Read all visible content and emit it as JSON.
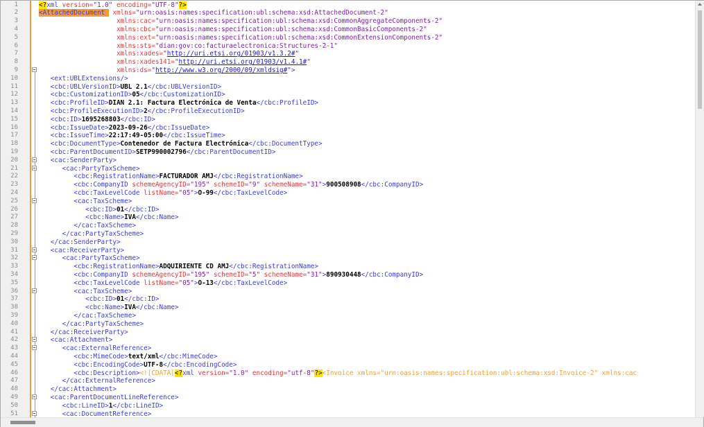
{
  "editor": {
    "lines": [
      {
        "n": "1",
        "segs": [
          [
            "pi",
            "<?"
          ],
          [
            "pitext",
            "xml "
          ],
          [
            "attr",
            "version="
          ],
          [
            "val",
            "\"1.0\""
          ],
          [
            "attr",
            " encoding="
          ],
          [
            "val",
            "\"UTF-8\""
          ],
          [
            "pi",
            "?>"
          ]
        ]
      },
      {
        "n": "2",
        "segs": [
          [
            "hl",
            "<AttachedDocument "
          ],
          [
            "attr",
            " xmlns="
          ],
          [
            "val",
            "\"urn:oasis:names:specification:ubl:schema:xsd:AttachedDocument-2\""
          ]
        ]
      },
      {
        "n": "3",
        "segs": [
          [
            "plain",
            "                    "
          ],
          [
            "attr",
            "xmlns:cac="
          ],
          [
            "val",
            "\"urn:oasis:names:specification:ubl:schema:xsd:CommonAggregateComponents-2\""
          ]
        ]
      },
      {
        "n": "4",
        "segs": [
          [
            "plain",
            "                    "
          ],
          [
            "attr",
            "xmlns:cbc="
          ],
          [
            "val",
            "\"urn:oasis:names:specification:ubl:schema:xsd:CommonBasicComponents-2\""
          ]
        ]
      },
      {
        "n": "5",
        "segs": [
          [
            "plain",
            "                    "
          ],
          [
            "attr",
            "xmlns:ext="
          ],
          [
            "val",
            "\"urn:oasis:names:specification:ubl:schema:xsd:CommonExtensionComponents-2\""
          ]
        ]
      },
      {
        "n": "6",
        "segs": [
          [
            "plain",
            "                    "
          ],
          [
            "attr",
            "xmlns:sts="
          ],
          [
            "val",
            "\"dian:gov:co:facturaelectronica:Structures-2-1\""
          ]
        ]
      },
      {
        "n": "7",
        "segs": [
          [
            "plain",
            "                    "
          ],
          [
            "attr",
            "xmlns:xades="
          ],
          [
            "val",
            "\""
          ],
          [
            "link",
            "http://uri.etsi.org/01903/v1.3.2#"
          ],
          [
            "val",
            "\""
          ]
        ]
      },
      {
        "n": "8",
        "segs": [
          [
            "plain",
            "                    "
          ],
          [
            "attr",
            "xmlns:xades141="
          ],
          [
            "val",
            "\""
          ],
          [
            "link",
            "http://uri.etsi.org/01903/v1.4.1#"
          ],
          [
            "val",
            "\""
          ]
        ]
      },
      {
        "n": "9",
        "fold": true,
        "segs": [
          [
            "plain",
            "                    "
          ],
          [
            "attr",
            "xmlns:ds="
          ],
          [
            "val",
            "\""
          ],
          [
            "link",
            "http://www.w3.org/2000/09/xmldsig#"
          ],
          [
            "val",
            "\""
          ],
          [
            "tag",
            ">"
          ]
        ]
      },
      {
        "n": "10",
        "segs": [
          [
            "plain",
            "   "
          ],
          [
            "tag",
            "<ext:UBLExtensions/>"
          ]
        ]
      },
      {
        "n": "11",
        "segs": [
          [
            "plain",
            "   "
          ],
          [
            "tag",
            "<cbc:UBLVersionID>"
          ],
          [
            "bold",
            "UBL 2.1"
          ],
          [
            "tag",
            "</cbc:UBLVersionID>"
          ]
        ]
      },
      {
        "n": "12",
        "segs": [
          [
            "plain",
            "   "
          ],
          [
            "tag",
            "<cbc:CustomizationID>"
          ],
          [
            "bold",
            "05"
          ],
          [
            "tag",
            "</cbc:CustomizationID>"
          ]
        ]
      },
      {
        "n": "13",
        "segs": [
          [
            "plain",
            "   "
          ],
          [
            "tag",
            "<cbc:ProfileID>"
          ],
          [
            "bold",
            "DIAN 2.1: Factura Electrónica de Venta"
          ],
          [
            "tag",
            "</cbc:ProfileID>"
          ]
        ]
      },
      {
        "n": "14",
        "segs": [
          [
            "plain",
            "   "
          ],
          [
            "tag",
            "<cbc:ProfileExecutionID>"
          ],
          [
            "bold",
            "2"
          ],
          [
            "tag",
            "</cbc:ProfileExecutionID>"
          ]
        ]
      },
      {
        "n": "15",
        "segs": [
          [
            "plain",
            "   "
          ],
          [
            "tag",
            "<cbc:ID>"
          ],
          [
            "bold",
            "1695268803"
          ],
          [
            "tag",
            "</cbc:ID>"
          ]
        ]
      },
      {
        "n": "16",
        "segs": [
          [
            "plain",
            "   "
          ],
          [
            "tag",
            "<cbc:IssueDate>"
          ],
          [
            "bold",
            "2023-09-26"
          ],
          [
            "tag",
            "</cbc:IssueDate>"
          ]
        ]
      },
      {
        "n": "17",
        "segs": [
          [
            "plain",
            "   "
          ],
          [
            "tag",
            "<cbc:IssueTime>"
          ],
          [
            "bold",
            "22:17:49-05:00"
          ],
          [
            "tag",
            "</cbc:IssueTime>"
          ]
        ]
      },
      {
        "n": "18",
        "segs": [
          [
            "plain",
            "   "
          ],
          [
            "tag",
            "<cbc:DocumentType>"
          ],
          [
            "bold",
            "Contenedor de Factura Electrónica"
          ],
          [
            "tag",
            "</cbc:DocumentType>"
          ]
        ]
      },
      {
        "n": "19",
        "segs": [
          [
            "plain",
            "   "
          ],
          [
            "tag",
            "<cbc:ParentDocumentID>"
          ],
          [
            "bold",
            "SETP990002796"
          ],
          [
            "tag",
            "</cbc:ParentDocumentID>"
          ]
        ]
      },
      {
        "n": "20",
        "fold": true,
        "segs": [
          [
            "plain",
            "   "
          ],
          [
            "tag",
            "<cac:SenderParty>"
          ]
        ]
      },
      {
        "n": "21",
        "fold": true,
        "segs": [
          [
            "plain",
            "      "
          ],
          [
            "tag",
            "<cac:PartyTaxScheme>"
          ]
        ]
      },
      {
        "n": "22",
        "segs": [
          [
            "plain",
            "         "
          ],
          [
            "tag",
            "<cbc:RegistrationName>"
          ],
          [
            "bold",
            "FACTURADOR AMJ"
          ],
          [
            "tag",
            "</cbc:RegistrationName>"
          ]
        ]
      },
      {
        "n": "23",
        "segs": [
          [
            "plain",
            "         "
          ],
          [
            "tag",
            "<cbc:CompanyID "
          ],
          [
            "attr",
            "schemeAgencyID="
          ],
          [
            "val",
            "\"195\""
          ],
          [
            "attr",
            " schemeID="
          ],
          [
            "val",
            "\"9\""
          ],
          [
            "attr",
            " schemeName="
          ],
          [
            "val",
            "\"31\""
          ],
          [
            "tag",
            ">"
          ],
          [
            "bold",
            "900508908"
          ],
          [
            "tag",
            "</cbc:CompanyID>"
          ]
        ]
      },
      {
        "n": "24",
        "segs": [
          [
            "plain",
            "         "
          ],
          [
            "tag",
            "<cbc:TaxLevelCode "
          ],
          [
            "attr",
            "listName="
          ],
          [
            "val",
            "\"05\""
          ],
          [
            "tag",
            ">"
          ],
          [
            "bold",
            "O-99"
          ],
          [
            "tag",
            "</cbc:TaxLevelCode>"
          ]
        ]
      },
      {
        "n": "25",
        "fold": true,
        "segs": [
          [
            "plain",
            "         "
          ],
          [
            "tag",
            "<cac:TaxScheme>"
          ]
        ]
      },
      {
        "n": "26",
        "segs": [
          [
            "plain",
            "            "
          ],
          [
            "tag",
            "<cbc:ID>"
          ],
          [
            "bold",
            "01"
          ],
          [
            "tag",
            "</cbc:ID>"
          ]
        ]
      },
      {
        "n": "27",
        "segs": [
          [
            "plain",
            "            "
          ],
          [
            "tag",
            "<cbc:Name>"
          ],
          [
            "bold",
            "IVA"
          ],
          [
            "tag",
            "</cbc:Name>"
          ]
        ]
      },
      {
        "n": "28",
        "segs": [
          [
            "plain",
            "         "
          ],
          [
            "tag",
            "</cac:TaxScheme>"
          ]
        ]
      },
      {
        "n": "29",
        "segs": [
          [
            "plain",
            "      "
          ],
          [
            "tag",
            "</cac:PartyTaxScheme>"
          ]
        ]
      },
      {
        "n": "30",
        "segs": [
          [
            "plain",
            "   "
          ],
          [
            "tag",
            "</cac:SenderParty>"
          ]
        ]
      },
      {
        "n": "31",
        "fold": true,
        "segs": [
          [
            "plain",
            "   "
          ],
          [
            "tag",
            "<cac:ReceiverParty>"
          ]
        ]
      },
      {
        "n": "32",
        "fold": true,
        "segs": [
          [
            "plain",
            "      "
          ],
          [
            "tag",
            "<cac:PartyTaxScheme>"
          ]
        ]
      },
      {
        "n": "33",
        "segs": [
          [
            "plain",
            "         "
          ],
          [
            "tag",
            "<cbc:RegistrationName>"
          ],
          [
            "bold",
            "ADQUIRIENTE CD AMJ"
          ],
          [
            "tag",
            "</cbc:RegistrationName>"
          ]
        ]
      },
      {
        "n": "34",
        "segs": [
          [
            "plain",
            "         "
          ],
          [
            "tag",
            "<cbc:CompanyID "
          ],
          [
            "attr",
            "schemeAgencyID="
          ],
          [
            "val",
            "\"195\""
          ],
          [
            "attr",
            " schemeID="
          ],
          [
            "val",
            "\"5\""
          ],
          [
            "attr",
            " schemeName="
          ],
          [
            "val",
            "\"31\""
          ],
          [
            "tag",
            ">"
          ],
          [
            "bold",
            "890930448"
          ],
          [
            "tag",
            "</cbc:CompanyID>"
          ]
        ]
      },
      {
        "n": "35",
        "segs": [
          [
            "plain",
            "         "
          ],
          [
            "tag",
            "<cbc:TaxLevelCode "
          ],
          [
            "attr",
            "listName="
          ],
          [
            "val",
            "\"05\""
          ],
          [
            "tag",
            ">"
          ],
          [
            "bold",
            "O-13"
          ],
          [
            "tag",
            "</cbc:TaxLevelCode>"
          ]
        ]
      },
      {
        "n": "36",
        "fold": true,
        "segs": [
          [
            "plain",
            "         "
          ],
          [
            "tag",
            "<cac:TaxScheme>"
          ]
        ]
      },
      {
        "n": "37",
        "segs": [
          [
            "plain",
            "            "
          ],
          [
            "tag",
            "<cbc:ID>"
          ],
          [
            "bold",
            "01"
          ],
          [
            "tag",
            "</cbc:ID>"
          ]
        ]
      },
      {
        "n": "38",
        "segs": [
          [
            "plain",
            "            "
          ],
          [
            "tag",
            "<cbc:Name>"
          ],
          [
            "bold",
            "IVA"
          ],
          [
            "tag",
            "</cbc:Name>"
          ]
        ]
      },
      {
        "n": "39",
        "segs": [
          [
            "plain",
            "         "
          ],
          [
            "tag",
            "</cac:TaxScheme>"
          ]
        ]
      },
      {
        "n": "40",
        "segs": [
          [
            "plain",
            "      "
          ],
          [
            "tag",
            "</cac:PartyTaxScheme>"
          ]
        ]
      },
      {
        "n": "41",
        "segs": [
          [
            "plain",
            "   "
          ],
          [
            "tag",
            "</cac:ReceiverParty>"
          ]
        ]
      },
      {
        "n": "42",
        "fold": true,
        "segs": [
          [
            "plain",
            "   "
          ],
          [
            "tag",
            "<cac:Attachment>"
          ]
        ]
      },
      {
        "n": "43",
        "fold": true,
        "segs": [
          [
            "plain",
            "      "
          ],
          [
            "tag",
            "<cac:ExternalReference>"
          ]
        ]
      },
      {
        "n": "44",
        "segs": [
          [
            "plain",
            "         "
          ],
          [
            "tag",
            "<cbc:MimeCode>"
          ],
          [
            "bold",
            "text/xml"
          ],
          [
            "tag",
            "</cbc:MimeCode>"
          ]
        ]
      },
      {
        "n": "45",
        "segs": [
          [
            "plain",
            "         "
          ],
          [
            "tag",
            "<cbc:EncodingCode>"
          ],
          [
            "bold",
            "UTF-8"
          ],
          [
            "tag",
            "</cbc:EncodingCode>"
          ]
        ]
      },
      {
        "n": "46",
        "segs": [
          [
            "plain",
            "         "
          ],
          [
            "tag",
            "<cbc:Description>"
          ],
          [
            "cdata",
            "<![CDATA["
          ],
          [
            "pi",
            "<?"
          ],
          [
            "pitext",
            "xml "
          ],
          [
            "attr",
            "version="
          ],
          [
            "val",
            "\"1.0\""
          ],
          [
            "attr",
            " encoding="
          ],
          [
            "val",
            "\"utf-8\""
          ],
          [
            "pi",
            "?>"
          ],
          [
            "cdata",
            "<Invoice xmlns=\"urn:oasis:names:specification:ubl:schema:xsd:Invoice-2\" xmlns:cac"
          ]
        ]
      },
      {
        "n": "47",
        "segs": [
          [
            "plain",
            "      "
          ],
          [
            "tag",
            "</cac:ExternalReference>"
          ]
        ]
      },
      {
        "n": "48",
        "segs": [
          [
            "plain",
            "   "
          ],
          [
            "tag",
            "</cac:Attachment>"
          ]
        ]
      },
      {
        "n": "49",
        "fold": true,
        "segs": [
          [
            "plain",
            "   "
          ],
          [
            "tag",
            "<cac:ParentDocumentLineReference>"
          ]
        ]
      },
      {
        "n": "50",
        "segs": [
          [
            "plain",
            "      "
          ],
          [
            "tag",
            "<cbc:LineID>"
          ],
          [
            "bold",
            "1"
          ],
          [
            "tag",
            "</cbc:LineID>"
          ]
        ]
      },
      {
        "n": "51",
        "fold": true,
        "segs": [
          [
            "plain",
            "      "
          ],
          [
            "tag",
            "<cac:DocumentReference>"
          ]
        ]
      }
    ]
  }
}
